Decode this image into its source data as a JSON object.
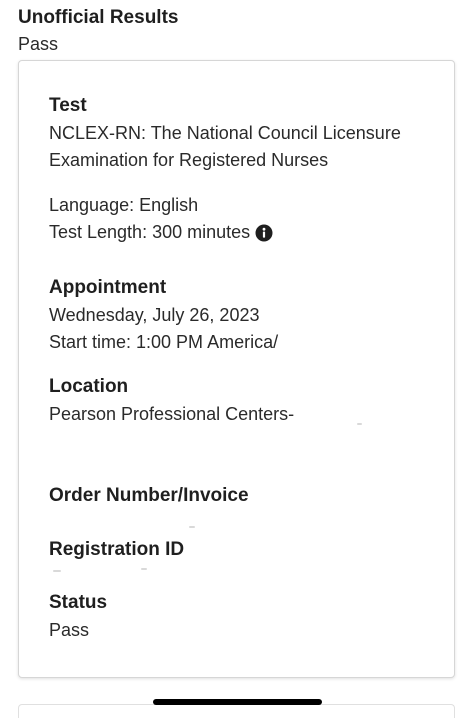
{
  "results": {
    "title": "Unofficial Results",
    "value": "Pass"
  },
  "card": {
    "test": {
      "label": "Test",
      "name_line1": "NCLEX-RN: The National Council Licensure",
      "name_line2": "Examination for Registered Nurses",
      "language": "Language:  English",
      "length": "Test Length: 300 minutes",
      "info_icon": "info-circle-icon"
    },
    "appointment": {
      "label": "Appointment",
      "date": "Wednesday, July 26, 2023",
      "start_time": "Start time: 1:00 PM America/"
    },
    "location": {
      "label": "Location",
      "value": "Pearson Professional Centers-"
    },
    "order": {
      "label": "Order Number/Invoice"
    },
    "registration": {
      "label": "Registration ID"
    },
    "status": {
      "label": "Status",
      "value": "Pass"
    }
  }
}
